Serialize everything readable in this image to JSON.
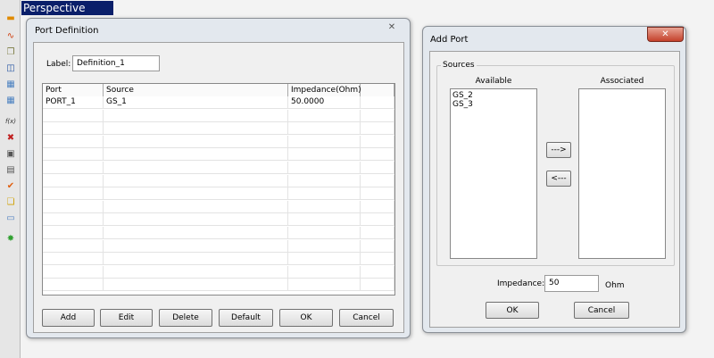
{
  "perspective": "Perspective",
  "toolbar": {
    "icons": [
      "ruler-icon",
      "waveform-icon",
      "layers-icon",
      "box-icon",
      "grid-icon",
      "grid-alt-icon",
      "function-icon",
      "excel-icon",
      "plot-icon",
      "image-icon",
      "check-icon",
      "copy-icon",
      "document-icon",
      "star-icon"
    ],
    "fx": "f(x)"
  },
  "port_def": {
    "title": "Port Definition",
    "label_text": "Label:",
    "label_value": "Definition_1",
    "columns": [
      "Port",
      "Source",
      "Impedance(Ohm)",
      ""
    ],
    "rows": [
      [
        "PORT_1",
        "GS_1",
        "50.0000"
      ]
    ],
    "buttons": {
      "add": "Add",
      "edit": "Edit",
      "delete": "Delete",
      "default": "Default",
      "ok": "OK",
      "cancel": "Cancel"
    }
  },
  "add_port": {
    "title": "Add Port",
    "close": "✕",
    "group": "Sources",
    "available_label": "Available",
    "associated_label": "Associated",
    "available": [
      "GS_2",
      "GS_3"
    ],
    "associated": [],
    "move_right": "--->",
    "move_left": "<---",
    "impedance_label": "Impedance:",
    "impedance_value": "50",
    "impedance_unit": "Ohm",
    "ok": "OK",
    "cancel": "Cancel"
  }
}
